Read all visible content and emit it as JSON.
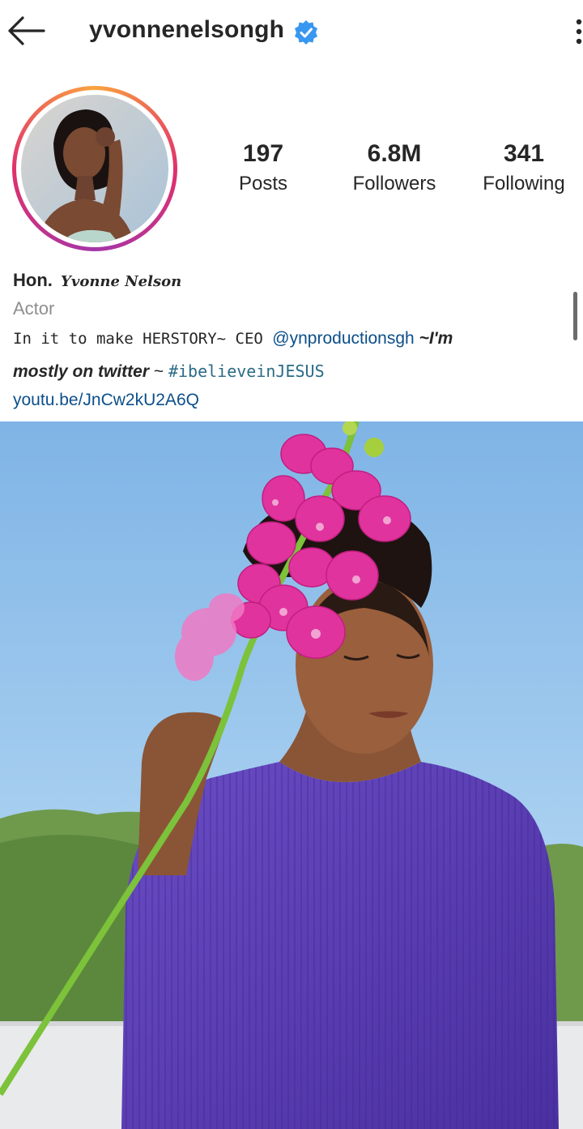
{
  "header": {
    "username": "yvonnenelsongh",
    "verified": true,
    "back_icon": "arrow-left-icon",
    "menu_icon": "more-vertical-icon",
    "accent_color": "#3897f0"
  },
  "stats": [
    {
      "value": "197",
      "label": "Posts"
    },
    {
      "value": "6.8M",
      "label": "Followers"
    },
    {
      "value": "341",
      "label": "Following"
    }
  ],
  "bio": {
    "name_prefix": "Hon.",
    "name_script": "Yvonne Nelson",
    "category": "Actor",
    "line1_text": "In it to make HERSTORY~ CEO ",
    "line1_mention": "@ynproductionsgh",
    "line1_suffix": " ~I'm",
    "line2_italic": "mostly on twitter",
    "line2_sep": " ~ ",
    "line2_hashtag": "#ibelieveinJESUS",
    "link": "youtu.be/JnCw2kU2A6Q"
  },
  "colors": {
    "ring_start": "#f9a33f",
    "ring_end": "#a436a8",
    "sweater": "#5b3fb0",
    "orchid": "#e0339d",
    "sky": "#8fc2ec"
  }
}
